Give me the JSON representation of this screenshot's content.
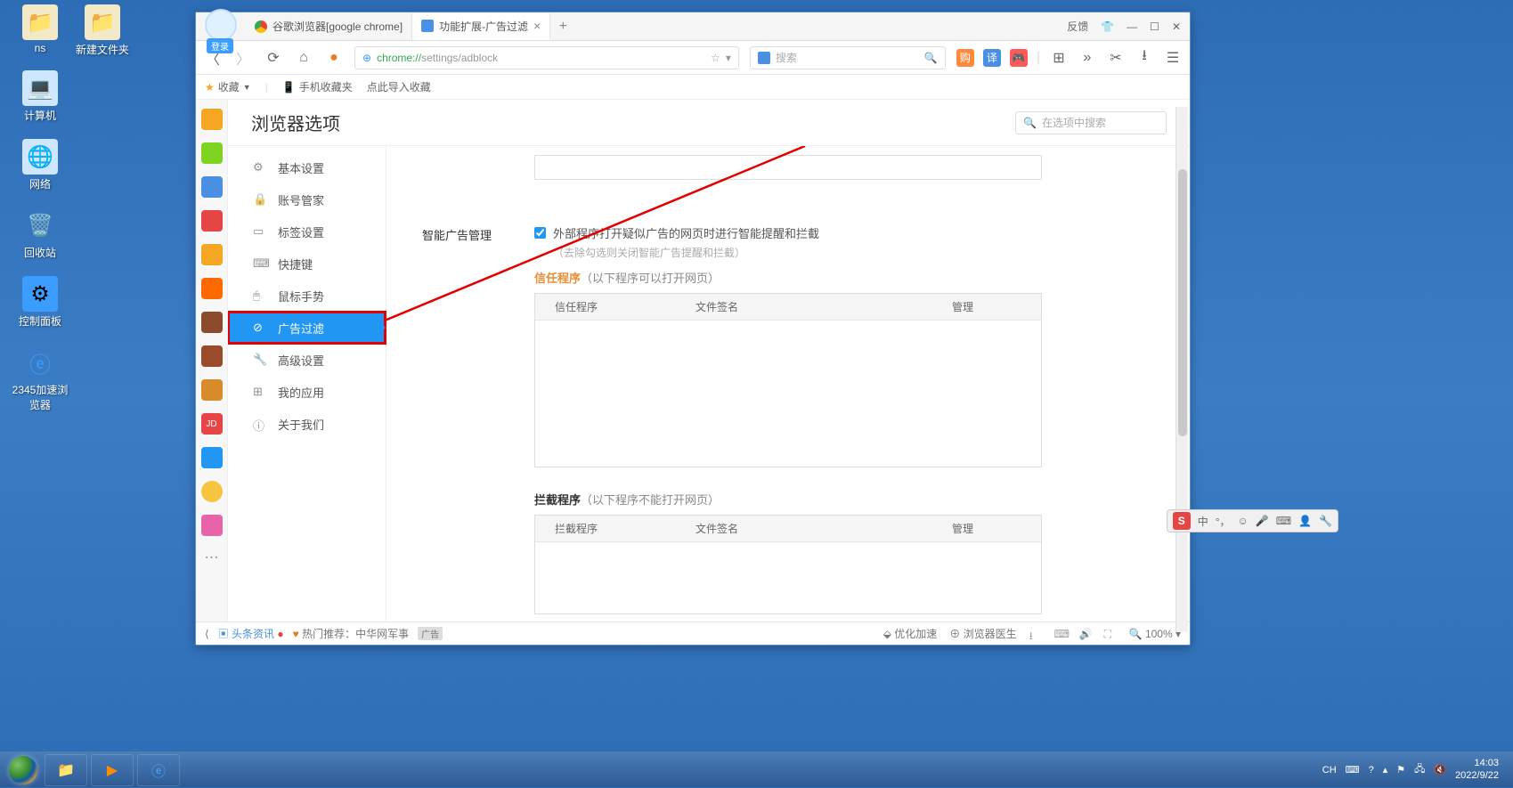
{
  "desktop": {
    "icons": [
      {
        "label": "ns"
      },
      {
        "label": "新建文件夹"
      },
      {
        "label": "计算机"
      },
      {
        "label": "网络"
      },
      {
        "label": "回收站"
      },
      {
        "label": "控制面板"
      },
      {
        "label": "2345加速浏览器"
      }
    ]
  },
  "browser": {
    "login_tag": "登录",
    "tabs": [
      {
        "title": "谷歌浏览器[google chrome]"
      },
      {
        "title": "功能扩展-广告过滤",
        "active": true
      }
    ],
    "window_controls": {
      "feedback": "反馈"
    },
    "address": {
      "url_green": "chrome://",
      "url_gray": "settings/adblock",
      "search_placeholder": "搜索"
    },
    "bookmarks": {
      "fav": "收藏",
      "mobile": "手机收藏夹",
      "import": "点此导入收藏"
    }
  },
  "settings": {
    "title": "浏览器选项",
    "search_placeholder": "在选项中搜索",
    "nav": [
      "基本设置",
      "账号管家",
      "标签设置",
      "快捷键",
      "鼠标手势",
      "广告过滤",
      "高级设置",
      "我的应用",
      "关于我们"
    ],
    "active_nav_index": 5,
    "sections": {
      "smart_ad": {
        "label": "智能广告管理",
        "checkbox_text": "外部程序打开疑似广告的网页时进行智能提醒和拦截",
        "hint": "（去除勾选则关闭智能广告提醒和拦截）"
      },
      "trust": {
        "title_strong": "信任程序",
        "title_note": "（以下程序可以打开网页）",
        "cols": [
          "信任程序",
          "文件签名",
          "管理"
        ]
      },
      "block": {
        "title_strong": "拦截程序",
        "title_note": "（以下程序不能打开网页）",
        "cols": [
          "拦截程序",
          "文件签名",
          "管理"
        ]
      }
    }
  },
  "statusbar": {
    "news": "头条资讯",
    "hot": "热门推荐：中华网军事",
    "ad_tag": "广告",
    "opt": "优化加速",
    "doctor": "浏览器医生",
    "zoom": "100%"
  },
  "ime": {
    "mode": "中"
  },
  "taskbar": {
    "tray": {
      "lang": "CH"
    },
    "time": "14:03",
    "date": "2022/9/22"
  }
}
